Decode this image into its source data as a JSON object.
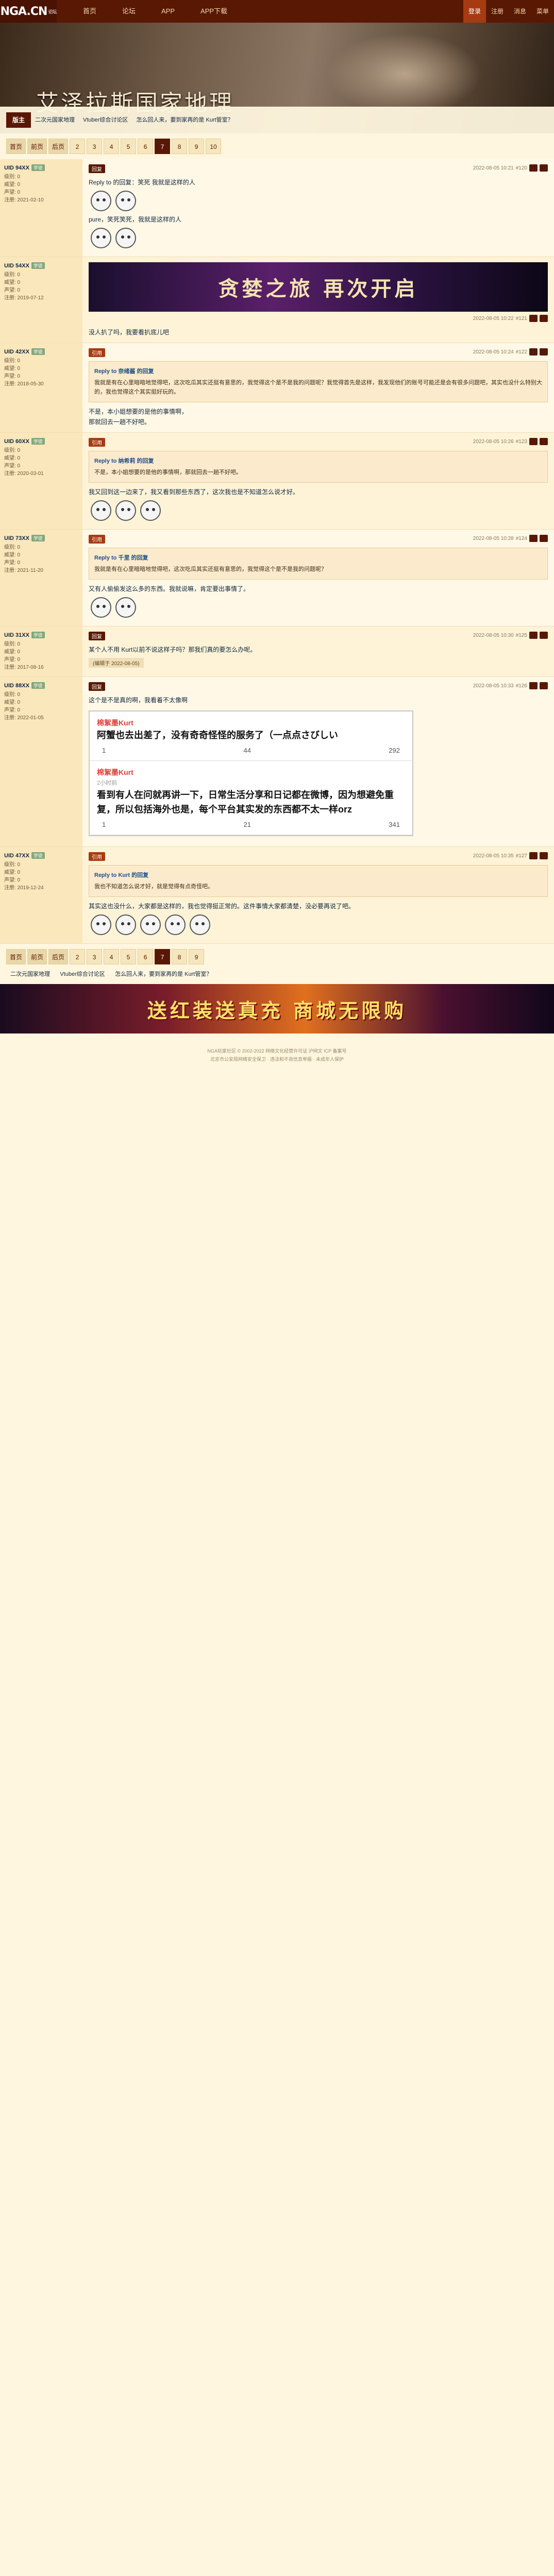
{
  "site": {
    "logo": "NGA.CN",
    "logo_sub": "论坛",
    "nav": [
      "首页",
      "论坛",
      "APP",
      "APP下载"
    ],
    "right": [
      "登录",
      "注册",
      "消息",
      "菜单"
    ]
  },
  "banner": {
    "title": "艾泽拉斯国家地理",
    "current": "版主",
    "subs": [
      "二次元国家地理",
      "Vtuber综合讨论区",
      "怎么回人来，要到家再的是 Kurt管室？"
    ]
  },
  "pager": {
    "items": [
      "首页",
      "前页",
      "后页",
      "2",
      "3",
      "4",
      "5",
      "6",
      "7",
      "8",
      "9",
      "10"
    ],
    "current": "7"
  },
  "posts": [
    {
      "user": "UID 94XX",
      "level": "学徒",
      "meta": [
        "级别: 0",
        "威望: 0",
        "声望: 0",
        "注册: 2021-02-10"
      ],
      "time": "2022-08-05 10:21",
      "floor": "#120",
      "text": "Reply to 的回复：笑死 我就是这样的人 ",
      "text2": "pure，笑死笑死，我就是这样的人"
    },
    {
      "user": "UID 54XX",
      "level": "学徒",
      "meta": [
        "级别: 0",
        "威望: 0",
        "声望: 0",
        "注册: 2019-07-12"
      ],
      "time": "2022-08-05 10:22",
      "floor": "#121",
      "ad": "贪婪之旅 再次开启",
      "text": "没人扒了吗，我要看扒底儿吧"
    },
    {
      "user": "UID 42XX",
      "level": "学徒",
      "meta": [
        "级别: 0",
        "威望: 0",
        "声望: 0",
        "注册: 2018-05-30"
      ],
      "time": "2022-08-05 10:24",
      "floor": "#122",
      "quote_head": "Reply to 奈绪酱 的回复",
      "quote": "我就是有在心里暗暗地觉得吧，这次吃瓜其实还挺有意思的，我觉得这个是不是我的问题呢？我觉得首先是这样，我发现他们的账号可能还是会有很多问题吧，其实也没什么特别大的，我也觉得这个其实挺好玩的。",
      "text": "不是，本小姐想要的是他的事情啊，",
      "text2": "那就回去一趟不好吧。"
    },
    {
      "user": "UID 60XX",
      "level": "学徒",
      "meta": [
        "级别: 0",
        "威望: 0",
        "声望: 0",
        "注册: 2020-03-01"
      ],
      "time": "2022-08-05 10:26",
      "floor": "#123",
      "quote_head": "Reply to 纳希莉 的回复",
      "quote": "不是，本小姐想要的是他的事情啊，那就回去一趟不好吧。",
      "text": "我又回到这一边来了，我又看到那些东西了，这次我也是不知道怎么说才好。"
    },
    {
      "user": "UID 73XX",
      "level": "学徒",
      "meta": [
        "级别: 0",
        "威望: 0",
        "声望: 0",
        "注册: 2021-11-20"
      ],
      "time": "2022-08-05 10:28",
      "floor": "#124",
      "quote_head": "Reply to 千里 的回复",
      "quote": "我就是有在心里暗暗地觉得吧，这次吃瓜其实还挺有意思的，我觉得这个是不是我的问题呢？",
      "text": "又有人偷偷发这么多的东西。我就说嘛，肯定要出事情了。"
    },
    {
      "user": "UID 31XX",
      "level": "学徒",
      "meta": [
        "级别: 0",
        "威望: 0",
        "声望: 0",
        "注册: 2017-08-16"
      ],
      "time": "2022-08-05 10:30",
      "floor": "#125",
      "text": "某个人不用 Kurt以前不说这样子吗？那我们真的要怎么办呢。",
      "note": "(编辑于 2022-08-05)"
    },
    {
      "user": "UID 88XX",
      "level": "学徒",
      "meta": [
        "级别: 0",
        "威望: 0",
        "声望: 0",
        "注册: 2022-01-05"
      ],
      "time": "2022-08-05 10:33",
      "floor": "#126",
      "text": "这个是不是真的啊，我看着不太像啊"
    },
    {
      "user": "UID 47XX",
      "level": "学徒",
      "meta": [
        "级别: 0",
        "威望: 0",
        "声望: 0",
        "注册: 2019-12-24"
      ],
      "time": "2022-08-05 10:35",
      "floor": "#127",
      "quote_head": "Reply to Kurt 的回复",
      "quote": "我也不知道怎么说才好，就是觉得有点奇怪吧。",
      "text": "其实这也没什么，大家都是这样的，我也觉得挺正常的。这件事情大家都清楚，没必要再说了吧。"
    }
  ],
  "weibo": [
    {
      "name": "棉絮墨Kurt",
      "time": "",
      "content": "阿蟹也去出差了，没有奇奇怪怪的服务了（一点点さびしい",
      "a": "1",
      "b": "44",
      "c": "292"
    },
    {
      "name": "棉絮墨Kurt",
      "time": "2小时前",
      "content": "看到有人在问就再讲一下，日常生活分享和日记都在微博，因为想避免重复，所以包括海外也是，每个平台其实发的东西都不太一样orz",
      "a": "1",
      "b": "21",
      "c": "341"
    }
  ],
  "ad2": "送红装送真充 商城无限购",
  "footer": [
    "NGA玩家社区 © 2002-2022 网络文化经营许可证 沪网文 ICP 备案号",
    "北京市公安局网络安全保卫 · 违法和不良信息举报 · 未成年人保护"
  ]
}
